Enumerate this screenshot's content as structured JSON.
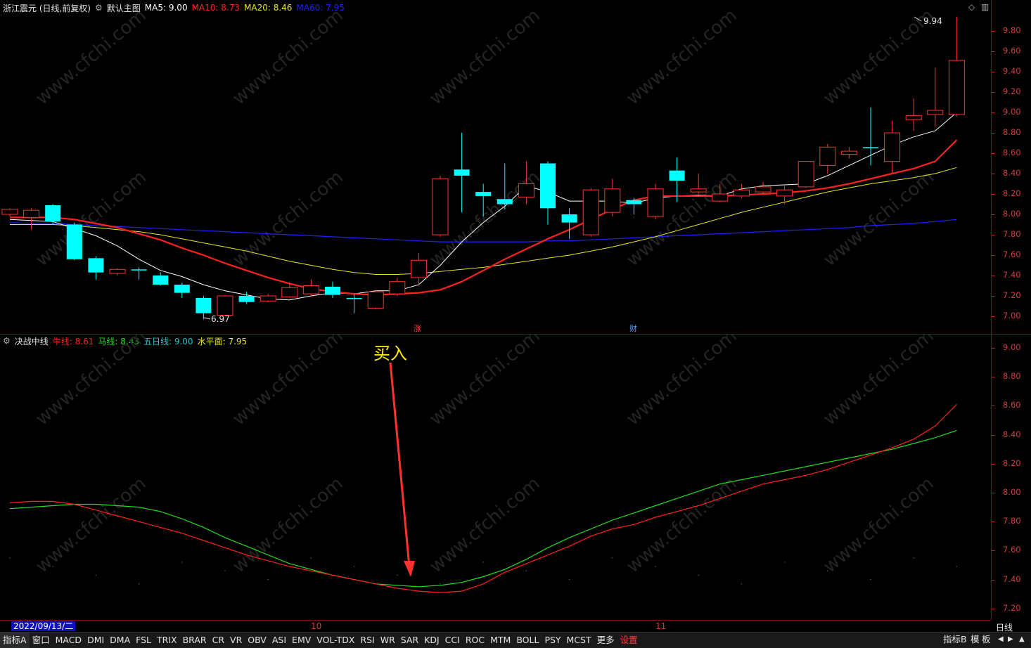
{
  "main": {
    "stock_name": "浙江震元 (日线,前复权)",
    "chart_label": "默认主图",
    "ma5": {
      "label": "MA5:",
      "value": "9.00",
      "color": "#ffffff"
    },
    "ma10": {
      "label": "MA10:",
      "value": "8.73",
      "color": "#ff2020"
    },
    "ma20": {
      "label": "MA20:",
      "value": "8.46",
      "color": "#e8e820"
    },
    "ma60": {
      "label": "MA60:",
      "value": "7.95",
      "color": "#2020ff"
    },
    "high_label": "9.94",
    "low_label": "6.97",
    "marker_zhang": "涨",
    "marker_cai": "财",
    "y_ticks": [
      "9.80",
      "9.60",
      "9.40",
      "9.20",
      "9.00",
      "8.80",
      "8.60",
      "8.40",
      "8.20",
      "8.00",
      "7.80",
      "7.60",
      "7.40",
      "7.20",
      "7.00"
    ]
  },
  "indicator": {
    "name": "决战中线",
    "niu": {
      "label": "牛线:",
      "value": "8.61",
      "color": "#ff2020"
    },
    "ma": {
      "label": "马线:",
      "value": "8.43",
      "color": "#20dd20"
    },
    "wuri": {
      "label": "五日线:",
      "value": "9.00",
      "color": "#20c8c8"
    },
    "shuiping": {
      "label": "水平面:",
      "value": "7.95",
      "color": "#e8e820"
    },
    "buy_annotation": "买入",
    "y_ticks": [
      "9.00",
      "8.80",
      "8.60",
      "8.40",
      "8.20",
      "8.00",
      "7.80",
      "7.60",
      "7.40",
      "7.20"
    ]
  },
  "xaxis": {
    "date_label": "2022/09/13/二",
    "month_10": "10",
    "month_11": "11",
    "period": "日线"
  },
  "tabs": [
    "指标A",
    "窗口",
    "MACD",
    "DMI",
    "DMA",
    "FSL",
    "TRIX",
    "BRAR",
    "CR",
    "VR",
    "OBV",
    "ASI",
    "EMV",
    "VOL-TDX",
    "RSI",
    "WR",
    "SAR",
    "KDJ",
    "CCI",
    "ROC",
    "MTM",
    "BOLL",
    "PSY",
    "MCST",
    "更多",
    "设置"
  ],
  "right_tabs": [
    "指标B",
    "模",
    "板"
  ],
  "watermark": "www.cfchi.com",
  "colors": {
    "up": "#ff3232",
    "down": "#00ffff",
    "bg": "#000000",
    "grid": "#7a1010"
  },
  "chart_data": {
    "type": "candlestick",
    "candles": [
      {
        "o": 8.0,
        "c": 8.05,
        "h": 8.06,
        "l": 7.98
      },
      {
        "o": 7.97,
        "c": 8.04,
        "h": 8.06,
        "l": 7.85
      },
      {
        "o": 8.09,
        "c": 7.93,
        "h": 8.1,
        "l": 7.9
      },
      {
        "o": 7.9,
        "c": 7.56,
        "h": 7.92,
        "l": 7.55
      },
      {
        "o": 7.57,
        "c": 7.43,
        "h": 7.59,
        "l": 7.36
      },
      {
        "o": 7.42,
        "c": 7.46,
        "h": 7.47,
        "l": 7.4
      },
      {
        "o": 7.46,
        "c": 7.45,
        "h": 7.48,
        "l": 7.36
      },
      {
        "o": 7.4,
        "c": 7.31,
        "h": 7.43,
        "l": 7.3
      },
      {
        "o": 7.31,
        "c": 7.23,
        "h": 7.33,
        "l": 7.18
      },
      {
        "o": 7.18,
        "c": 7.03,
        "h": 7.2,
        "l": 6.97
      },
      {
        "o": 7.01,
        "c": 7.2,
        "h": 7.21,
        "l": 7.0
      },
      {
        "o": 7.2,
        "c": 7.14,
        "h": 7.24,
        "l": 7.12
      },
      {
        "o": 7.15,
        "c": 7.2,
        "h": 7.22,
        "l": 7.14
      },
      {
        "o": 7.19,
        "c": 7.28,
        "h": 7.33,
        "l": 7.18
      },
      {
        "o": 7.22,
        "c": 7.3,
        "h": 7.36,
        "l": 7.2
      },
      {
        "o": 7.29,
        "c": 7.21,
        "h": 7.34,
        "l": 7.18
      },
      {
        "o": 7.18,
        "c": 7.17,
        "h": 7.22,
        "l": 7.03
      },
      {
        "o": 7.08,
        "c": 7.24,
        "h": 7.26,
        "l": 7.07
      },
      {
        "o": 7.22,
        "c": 7.34,
        "h": 7.38,
        "l": 7.2
      },
      {
        "o": 7.38,
        "c": 7.55,
        "h": 7.62,
        "l": 7.3
      },
      {
        "o": 7.8,
        "c": 8.35,
        "h": 8.38,
        "l": 7.78
      },
      {
        "o": 8.44,
        "c": 8.38,
        "h": 8.8,
        "l": 8.02
      },
      {
        "o": 8.22,
        "c": 8.18,
        "h": 8.3,
        "l": 7.98
      },
      {
        "o": 8.15,
        "c": 8.1,
        "h": 8.5,
        "l": 8.05
      },
      {
        "o": 8.17,
        "c": 8.3,
        "h": 8.52,
        "l": 8.1
      },
      {
        "o": 8.5,
        "c": 8.06,
        "h": 8.52,
        "l": 7.9
      },
      {
        "o": 8.0,
        "c": 7.92,
        "h": 8.06,
        "l": 7.76
      },
      {
        "o": 7.8,
        "c": 8.24,
        "h": 8.26,
        "l": 7.78
      },
      {
        "o": 8.02,
        "c": 8.25,
        "h": 8.35,
        "l": 7.98
      },
      {
        "o": 8.14,
        "c": 8.1,
        "h": 8.16,
        "l": 8.0
      },
      {
        "o": 7.98,
        "c": 8.25,
        "h": 8.3,
        "l": 7.95
      },
      {
        "o": 8.43,
        "c": 8.33,
        "h": 8.56,
        "l": 8.12
      },
      {
        "o": 8.22,
        "c": 8.25,
        "h": 8.4,
        "l": 8.2
      },
      {
        "o": 8.13,
        "c": 8.2,
        "h": 8.3,
        "l": 8.12
      },
      {
        "o": 8.18,
        "c": 8.24,
        "h": 8.3,
        "l": 8.16
      },
      {
        "o": 8.22,
        "c": 8.27,
        "h": 8.32,
        "l": 8.2
      },
      {
        "o": 8.18,
        "c": 8.24,
        "h": 8.28,
        "l": 8.1
      },
      {
        "o": 8.27,
        "c": 8.52,
        "h": 8.52,
        "l": 8.26
      },
      {
        "o": 8.48,
        "c": 8.66,
        "h": 8.69,
        "l": 8.4
      },
      {
        "o": 8.59,
        "c": 8.62,
        "h": 8.66,
        "l": 8.55
      },
      {
        "o": 8.66,
        "c": 8.65,
        "h": 9.05,
        "l": 8.48
      },
      {
        "o": 8.52,
        "c": 8.8,
        "h": 8.92,
        "l": 8.4
      },
      {
        "o": 8.93,
        "c": 8.97,
        "h": 9.14,
        "l": 8.82
      },
      {
        "o": 8.98,
        "c": 9.02,
        "h": 9.44,
        "l": 8.86
      },
      {
        "o": 8.98,
        "c": 9.51,
        "h": 9.94,
        "l": 8.96
      }
    ],
    "ma5": [
      7.95,
      7.94,
      7.93,
      7.86,
      7.79,
      7.69,
      7.56,
      7.45,
      7.39,
      7.31,
      7.25,
      7.21,
      7.17,
      7.16,
      7.2,
      7.23,
      7.22,
      7.25,
      7.25,
      7.31,
      7.5,
      7.73,
      7.92,
      8.08,
      8.28,
      8.22,
      8.13,
      8.13,
      8.13,
      8.11,
      8.16,
      8.18,
      8.19,
      8.18,
      8.25,
      8.28,
      8.29,
      8.3,
      8.38,
      8.48,
      8.58,
      8.68,
      8.76,
      8.82,
      9.0
    ],
    "ma10": [
      7.97,
      7.97,
      7.97,
      7.95,
      7.91,
      7.87,
      7.81,
      7.75,
      7.67,
      7.6,
      7.52,
      7.45,
      7.38,
      7.32,
      7.27,
      7.24,
      7.22,
      7.21,
      7.22,
      7.23,
      7.26,
      7.34,
      7.45,
      7.56,
      7.66,
      7.76,
      7.85,
      7.95,
      8.05,
      8.14,
      8.18,
      8.18,
      8.18,
      8.18,
      8.19,
      8.2,
      8.21,
      8.23,
      8.26,
      8.3,
      8.35,
      8.4,
      8.45,
      8.52,
      8.73
    ],
    "ma20": [
      7.9,
      7.9,
      7.9,
      7.89,
      7.87,
      7.85,
      7.83,
      7.8,
      7.76,
      7.72,
      7.68,
      7.64,
      7.59,
      7.54,
      7.5,
      7.46,
      7.43,
      7.41,
      7.41,
      7.42,
      7.44,
      7.46,
      7.48,
      7.51,
      7.54,
      7.57,
      7.6,
      7.64,
      7.68,
      7.73,
      7.78,
      7.84,
      7.9,
      7.96,
      8.02,
      8.07,
      8.12,
      8.17,
      8.22,
      8.26,
      8.3,
      8.33,
      8.36,
      8.4,
      8.46
    ],
    "ma60": [
      7.92,
      7.91,
      7.91,
      7.9,
      7.89,
      7.88,
      7.87,
      7.86,
      7.85,
      7.84,
      7.83,
      7.82,
      7.81,
      7.8,
      7.79,
      7.78,
      7.77,
      7.76,
      7.75,
      7.74,
      7.73,
      7.73,
      7.73,
      7.73,
      7.73,
      7.74,
      7.74,
      7.75,
      7.76,
      7.77,
      7.78,
      7.79,
      7.8,
      7.81,
      7.82,
      7.83,
      7.84,
      7.85,
      7.86,
      7.87,
      7.89,
      7.9,
      7.91,
      7.93,
      7.95
    ],
    "niu": [
      7.93,
      7.94,
      7.94,
      7.92,
      7.88,
      7.84,
      7.8,
      7.76,
      7.72,
      7.67,
      7.62,
      7.57,
      7.53,
      7.49,
      7.46,
      7.43,
      7.4,
      7.37,
      7.34,
      7.32,
      7.31,
      7.32,
      7.37,
      7.45,
      7.51,
      7.57,
      7.63,
      7.7,
      7.75,
      7.78,
      7.83,
      7.87,
      7.91,
      7.96,
      8.01,
      8.06,
      8.09,
      8.12,
      8.16,
      8.21,
      8.26,
      8.31,
      8.37,
      8.46,
      8.61
    ],
    "ma_line": [
      7.89,
      7.9,
      7.91,
      7.92,
      7.92,
      7.91,
      7.9,
      7.87,
      7.82,
      7.76,
      7.69,
      7.63,
      7.57,
      7.51,
      7.47,
      7.43,
      7.4,
      7.37,
      7.36,
      7.35,
      7.36,
      7.38,
      7.42,
      7.47,
      7.54,
      7.62,
      7.69,
      7.75,
      7.81,
      7.86,
      7.91,
      7.96,
      8.01,
      8.06,
      8.09,
      8.12,
      8.15,
      8.18,
      8.21,
      8.24,
      8.27,
      8.3,
      8.34,
      8.38,
      8.43
    ]
  }
}
